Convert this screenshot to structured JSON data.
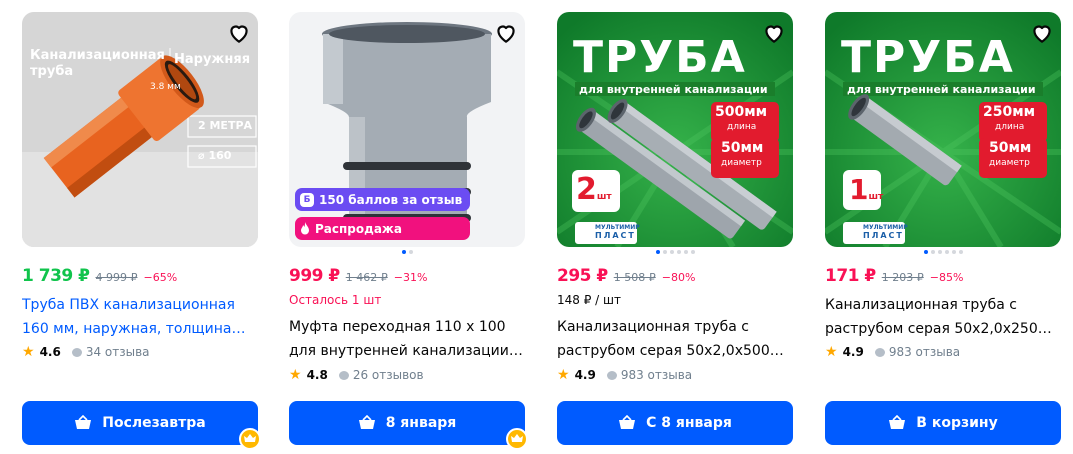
{
  "cards": [
    {
      "image": {
        "title_line1": "Канализационная",
        "title_line2": "труба",
        "tag": "Наружняя",
        "thickness": "3.8 мм",
        "length": "2 МЕТРА",
        "diameter": "⌀ 160"
      },
      "price": "1 739 ₽",
      "old_price": "4 999 ₽",
      "discount": "−65%",
      "title_line1": "Труба ПВХ канализационная",
      "title_line2": "160 мм, наружная, толщина…",
      "rating": "4.6",
      "reviews": "34 отзыва",
      "button": "Послезавтра",
      "dots": 0
    },
    {
      "badges": {
        "points": "150 баллов за отзыв",
        "sale": "Распродажа"
      },
      "price": "999 ₽",
      "old_price": "1 462 ₽",
      "discount": "−31%",
      "stock": "Осталось 1 шт",
      "title_line1": "Муфта переходная 110 х 100",
      "title_line2": "для внутренней канализации…",
      "rating": "4.8",
      "reviews": "26 отзывов",
      "button": "8 января",
      "dots": 2
    },
    {
      "image": {
        "headline": "ТРУБА",
        "subline": "для внутренней канализации",
        "length_val": "500мм",
        "length_label": "длина",
        "diam_val": "50мм",
        "diam_label": "диаметр",
        "qty": "2",
        "qty_unit": "шт",
        "brand1": "МУЛЬТИМИР",
        "brand2": "ПЛАСТ"
      },
      "price": "295 ₽",
      "old_price": "1 508 ₽",
      "discount": "−80%",
      "unit_price": "148 ₽ / шт",
      "title_line1": "Канализационная труба с",
      "title_line2": "раструбом серая 50х2,0х500…",
      "rating": "4.9",
      "reviews": "983 отзыва",
      "button": "С 8 января",
      "dots": 6
    },
    {
      "image": {
        "headline": "ТРУБА",
        "subline": "для внутренней канализации",
        "length_val": "250мм",
        "length_label": "длина",
        "diam_val": "50мм",
        "diam_label": "диаметр",
        "qty": "1",
        "qty_unit": "шт",
        "brand1": "МУЛЬТИМИР",
        "brand2": "ПЛАСТ"
      },
      "price": "171 ₽",
      "old_price": "1 203 ₽",
      "discount": "−85%",
      "title_line1": "Канализационная труба с",
      "title_line2": "раструбом серая 50х2,0х250…",
      "rating": "4.9",
      "reviews": "983 отзыва",
      "button": "В корзину",
      "dots": 6
    }
  ],
  "colors": {
    "accent": "#005bff",
    "price_green": "#10c44c",
    "price_red": "#f91155",
    "sale_pink": "#f1117e",
    "points_purple": "#6b4cf2",
    "rating_star": "#ffa800",
    "muted": "#707f8d"
  },
  "icons": {
    "favorite": "heart-outline-icon",
    "cart": "cart-icon",
    "star": "star-icon",
    "reviews": "chat-bubble-icon",
    "premium": "crown-icon",
    "flame": "flame-icon",
    "points": "points-b-icon"
  }
}
